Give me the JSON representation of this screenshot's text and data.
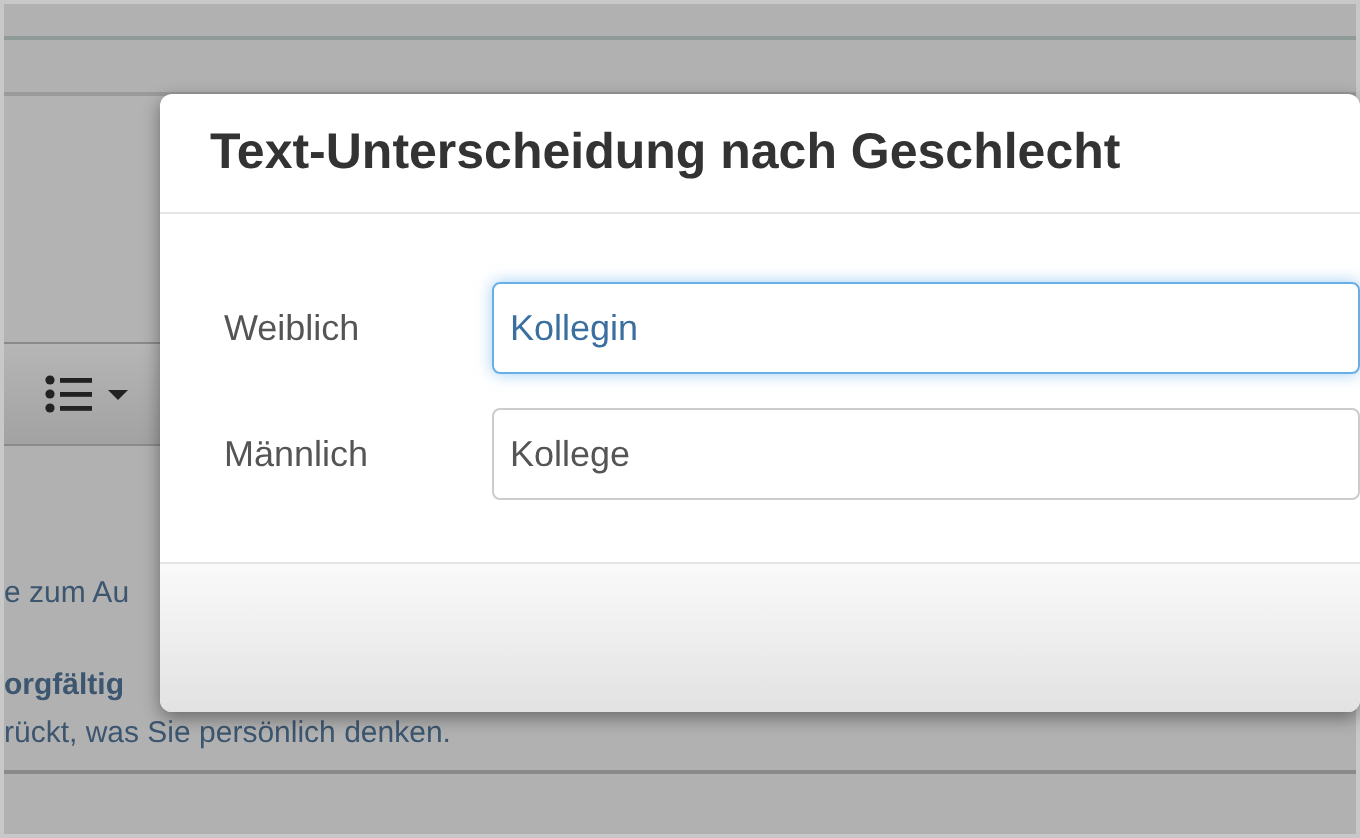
{
  "background": {
    "texts": [
      {
        "text": "e zum Au",
        "bold": false
      },
      {
        "text": "orgfältig",
        "bold": true
      },
      {
        "text": "rückt, was Sie persönlich denken.",
        "bold": false
      }
    ]
  },
  "dialog": {
    "title": "Text-Unterscheidung nach Geschlecht",
    "fields": [
      {
        "label": "Weiblich",
        "value": "Kollegin",
        "focused": true
      },
      {
        "label": "Männlich",
        "value": "Kollege",
        "focused": false
      }
    ]
  }
}
